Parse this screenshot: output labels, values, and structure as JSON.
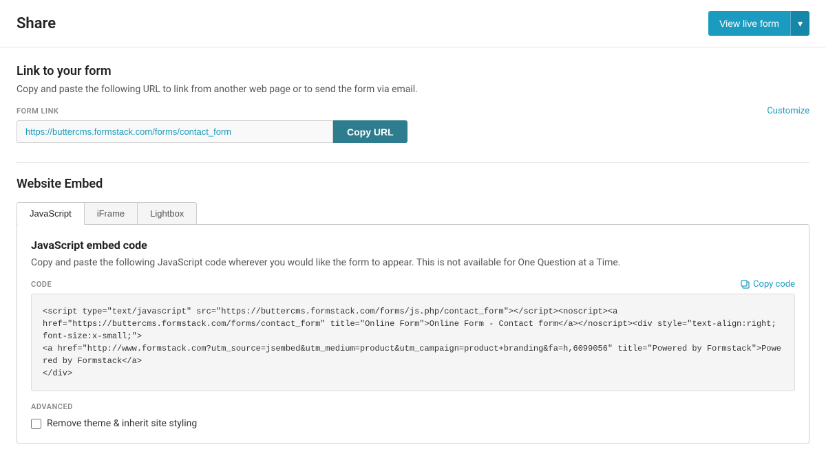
{
  "header": {
    "title": "Share",
    "view_live_btn": "View live form",
    "dropdown_arrow": "▾"
  },
  "link_section": {
    "title": "Link to your form",
    "description": "Copy and paste the following URL to link from another web page or to send the form via email.",
    "form_link_label": "FORM LINK",
    "customize_label": "Customize",
    "url_value": "https://buttercms.formstack.com/forms/contact_form",
    "copy_url_btn": "Copy URL"
  },
  "embed_section": {
    "title": "Website Embed",
    "tabs": [
      {
        "id": "javascript",
        "label": "JavaScript",
        "active": true
      },
      {
        "id": "iframe",
        "label": "iFrame",
        "active": false
      },
      {
        "id": "lightbox",
        "label": "Lightbox",
        "active": false
      }
    ],
    "panel": {
      "embed_title": "JavaScript embed code",
      "embed_desc": "Copy and paste the following JavaScript code wherever you would like the form to appear. This is not available for One Question at a Time.",
      "code_label": "CODE",
      "copy_code_btn": "Copy code",
      "code_content": "<script type=\"text/javascript\" src=\"https://buttercms.formstack.com/forms/js.php/contact_form\"></script><noscript><a\nhref=\"https://buttercms.formstack.com/forms/contact_form\" title=\"Online Form\">Online Form - Contact form</a></noscript><div style=\"text-align:right; font-size:x-small;\">\n<a href=\"http://www.formstack.com?utm_source=jsembed&utm_medium=product&utm_campaign=product+branding&fa=h,6099056\" title=\"Powered by Formstack\">Powered by Formstack</a>\n</div>",
      "advanced_label": "ADVANCED",
      "checkbox_label": "Remove theme & inherit site styling"
    }
  }
}
